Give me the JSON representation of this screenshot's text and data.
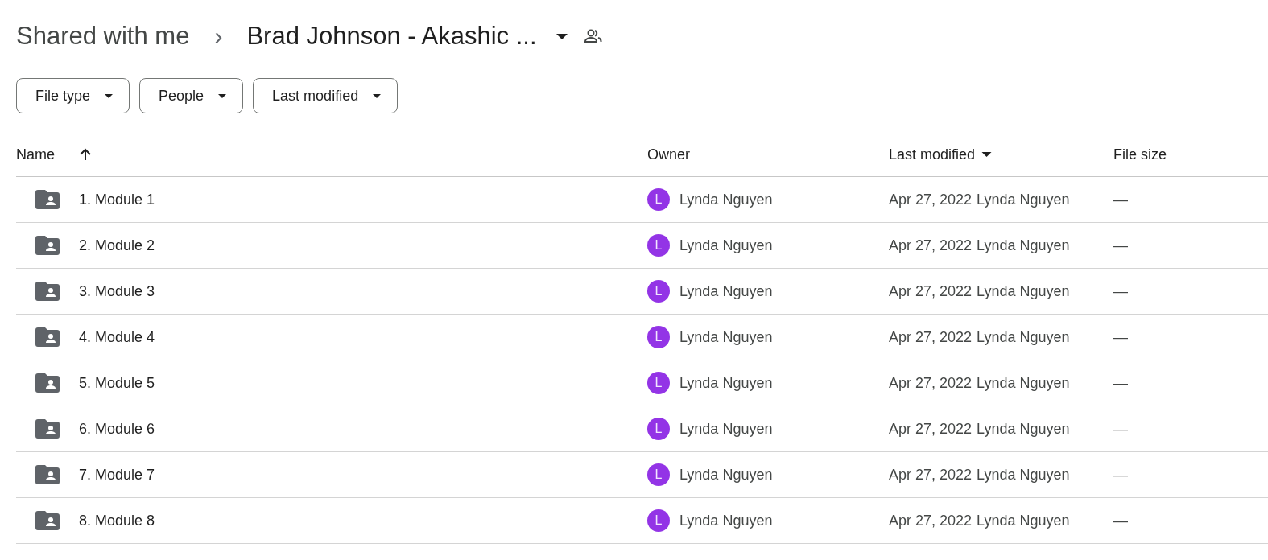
{
  "breadcrumb": {
    "parent": "Shared with me",
    "separator": "›",
    "current": "Brad Johnson - Akashic ..."
  },
  "filters": [
    {
      "label": "File type"
    },
    {
      "label": "People"
    },
    {
      "label": "Last modified"
    }
  ],
  "table": {
    "columns": [
      {
        "label": "Name",
        "kind": "sorted"
      },
      {
        "label": "Owner",
        "kind": "plain"
      },
      {
        "label": "Last modified",
        "kind": "dropdown"
      },
      {
        "label": "File size",
        "kind": "plain"
      }
    ],
    "rows": [
      {
        "name": "1. Module 1",
        "owner_initial": "L",
        "owner": "Lynda Nguyen",
        "modified": "Apr 27, 2022",
        "modified_by": "Lynda Nguyen",
        "size": "—"
      },
      {
        "name": "2. Module 2",
        "owner_initial": "L",
        "owner": "Lynda Nguyen",
        "modified": "Apr 27, 2022",
        "modified_by": "Lynda Nguyen",
        "size": "—"
      },
      {
        "name": "3. Module 3",
        "owner_initial": "L",
        "owner": "Lynda Nguyen",
        "modified": "Apr 27, 2022",
        "modified_by": "Lynda Nguyen",
        "size": "—"
      },
      {
        "name": "4. Module 4",
        "owner_initial": "L",
        "owner": "Lynda Nguyen",
        "modified": "Apr 27, 2022",
        "modified_by": "Lynda Nguyen",
        "size": "—"
      },
      {
        "name": "5. Module 5",
        "owner_initial": "L",
        "owner": "Lynda Nguyen",
        "modified": "Apr 27, 2022",
        "modified_by": "Lynda Nguyen",
        "size": "—"
      },
      {
        "name": "6. Module 6",
        "owner_initial": "L",
        "owner": "Lynda Nguyen",
        "modified": "Apr 27, 2022",
        "modified_by": "Lynda Nguyen",
        "size": "—"
      },
      {
        "name": "7. Module 7",
        "owner_initial": "L",
        "owner": "Lynda Nguyen",
        "modified": "Apr 27, 2022",
        "modified_by": "Lynda Nguyen",
        "size": "—"
      },
      {
        "name": "8. Module 8",
        "owner_initial": "L",
        "owner": "Lynda Nguyen",
        "modified": "Apr 27, 2022",
        "modified_by": "Lynda Nguyen",
        "size": "—"
      }
    ]
  }
}
